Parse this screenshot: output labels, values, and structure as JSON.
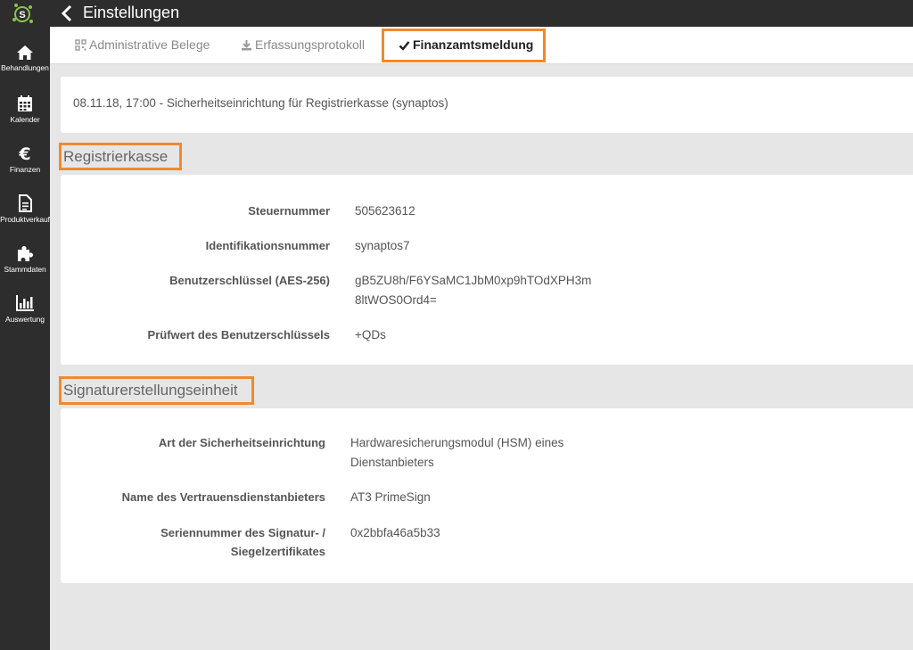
{
  "sidebar": {
    "logo": "synaptos-logo",
    "items": [
      {
        "label": "Behandlungen",
        "icon": "home-icon"
      },
      {
        "label": "Kalender",
        "icon": "calendar-icon"
      },
      {
        "label": "Finanzen",
        "icon": "euro-icon"
      },
      {
        "label": "Produktverkauf",
        "icon": "document-icon"
      },
      {
        "label": "Stammdaten",
        "icon": "puzzle-icon"
      },
      {
        "label": "Auswertung",
        "icon": "bar-chart-icon"
      }
    ]
  },
  "header": {
    "title": "Einstellungen"
  },
  "tabs": [
    {
      "label": "Administrative Belege",
      "icon": "qr-code-icon"
    },
    {
      "label": "Erfassungsprotokoll",
      "icon": "download-icon"
    },
    {
      "label": "Finanzamtsmeldung",
      "icon": "check-icon",
      "active": true
    }
  ],
  "log_entry": "08.11.18, 17:00 - Sicherheitseinrichtung für Registrierkasse (synaptos)",
  "registrierkasse": {
    "title": "Registrierkasse",
    "rows": [
      {
        "label": "Steuernummer",
        "value": "505623612"
      },
      {
        "label": "Identifikationsnummer",
        "value": "synaptos7"
      },
      {
        "label": "Benutzerschlüssel (AES-256)",
        "value_line1": "gB5ZU8h/F6YSaMC1JbM0xp9hTOdXPH3m",
        "value_line2": "8ltWOS0Ord4="
      },
      {
        "label": "Prüfwert des Benutzerschlüssels",
        "value": "+QDs"
      }
    ]
  },
  "signatur": {
    "title": "Signaturerstellungseinheit",
    "rows": [
      {
        "label": "Art der Sicherheitseinrichtung",
        "value_line1": "Hardwaresicherungsmodul (HSM) eines",
        "value_line2": "Dienstanbieters"
      },
      {
        "label": "Name des Vertrauensdienstanbieters",
        "value": "AT3 PrimeSign"
      },
      {
        "label_line1": "Seriennummer des Signatur- /",
        "label_line2": "Siegelzertifikates",
        "value": "0x2bbfa46a5b33"
      }
    ]
  },
  "colors": {
    "highlight": "#f08a2c",
    "dark": "#2d2d2d",
    "logo_green": "#8bc34a"
  }
}
